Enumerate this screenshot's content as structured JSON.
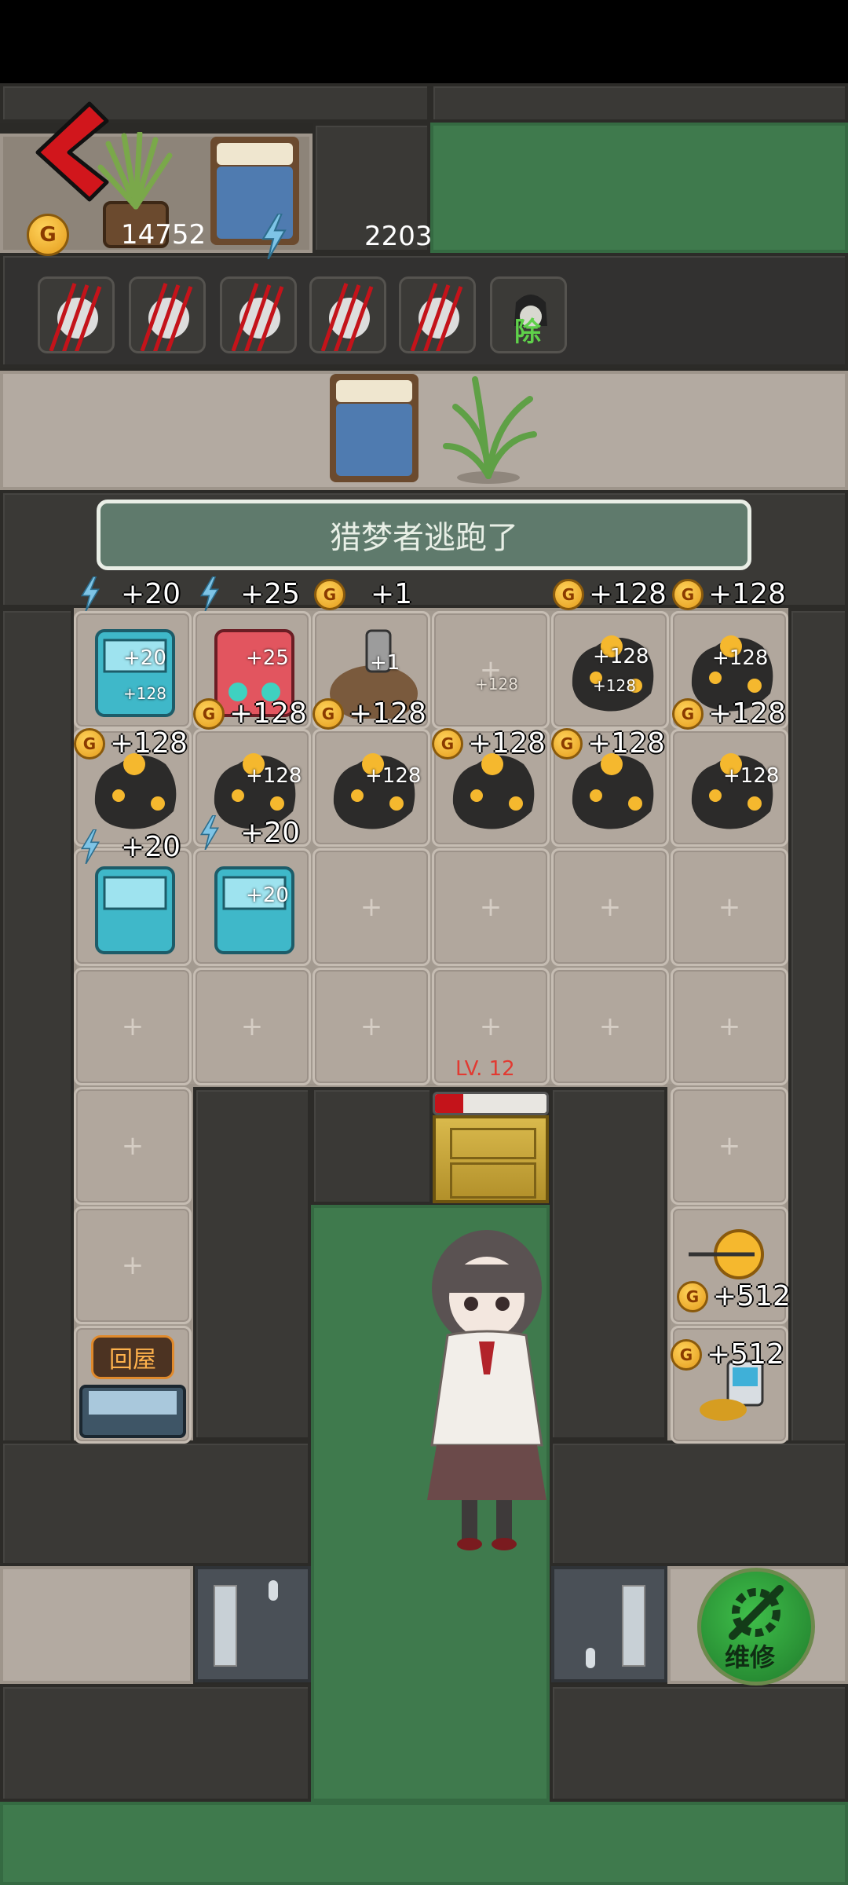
{
  "hud": {
    "gold": "14752",
    "energy": "2203",
    "coin_letter": "G"
  },
  "enemies": [
    {
      "name": "claw-marked-hunter-icon"
    },
    {
      "name": "claw-marked-hunter-icon"
    },
    {
      "name": "claw-marked-hunter-icon"
    },
    {
      "name": "claw-marked-hunter-icon"
    },
    {
      "name": "claw-marked-hunter-icon"
    },
    {
      "name": "green-ghost-icon",
      "label": "除"
    }
  ],
  "toast": "猎梦者逃跑了",
  "grid": {
    "row1": [
      "+20",
      "+25",
      "+1",
      "",
      "+128",
      "+128"
    ],
    "row1_inner": [
      "+20",
      "+25",
      "+1",
      "+128",
      "+128",
      "+128"
    ],
    "row1_inner_sub": [
      "+128",
      "",
      "",
      "",
      "+128",
      ""
    ],
    "row2": [
      "+128",
      "+128",
      "+128",
      "+128",
      "+128",
      "+128"
    ],
    "row2_inner": [
      "",
      "+128",
      "+128",
      "",
      "",
      "+128"
    ],
    "row3": [
      "+20",
      "+20"
    ],
    "row3_inner": [
      "",
      "+20"
    ]
  },
  "door": {
    "level": "LV. 12",
    "progress": 0.25
  },
  "side_items": {
    "turret_value": "+512",
    "device_value": "+512"
  },
  "home_button": "回屋",
  "repair_button": "维修",
  "colors": {
    "accent_green": "#3fbf4a",
    "wall": "#3a3936",
    "floor": "#b3aaa1",
    "grass": "#3f7a4d",
    "gold": "#e49b1b"
  }
}
